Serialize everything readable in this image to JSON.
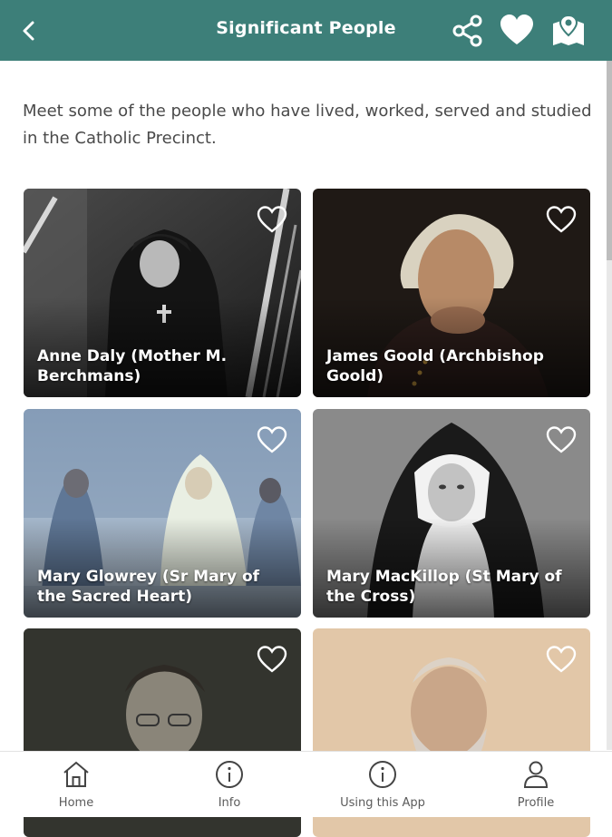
{
  "header": {
    "title": "Significant People",
    "back_icon": "chevron-left-icon",
    "share_icon": "share-icon",
    "favorites_icon": "heart-filled-icon",
    "map_icon": "map-marker-icon",
    "bar_color": "#3d7f79"
  },
  "intro": "Meet some of the people who have lived, worked, served and studied in the Catholic Precinct.",
  "people": [
    {
      "name": "Anne Daly (Mother M. Berchmans)",
      "favorited": false
    },
    {
      "name": "James Goold (Archbishop Goold)",
      "favorited": false
    },
    {
      "name": "Mary Glowrey (Sr Mary of the Sacred Heart)",
      "favorited": false
    },
    {
      "name": "Mary MacKillop (St Mary of the Cross)",
      "favorited": false
    },
    {
      "name": "",
      "favorited": false
    },
    {
      "name": "",
      "favorited": false
    }
  ],
  "bottom_nav": [
    {
      "label": "Home",
      "icon": "home-icon"
    },
    {
      "label": "Info",
      "icon": "info-icon"
    },
    {
      "label": "Using this App",
      "icon": "info-icon"
    },
    {
      "label": "Profile",
      "icon": "person-icon"
    }
  ]
}
